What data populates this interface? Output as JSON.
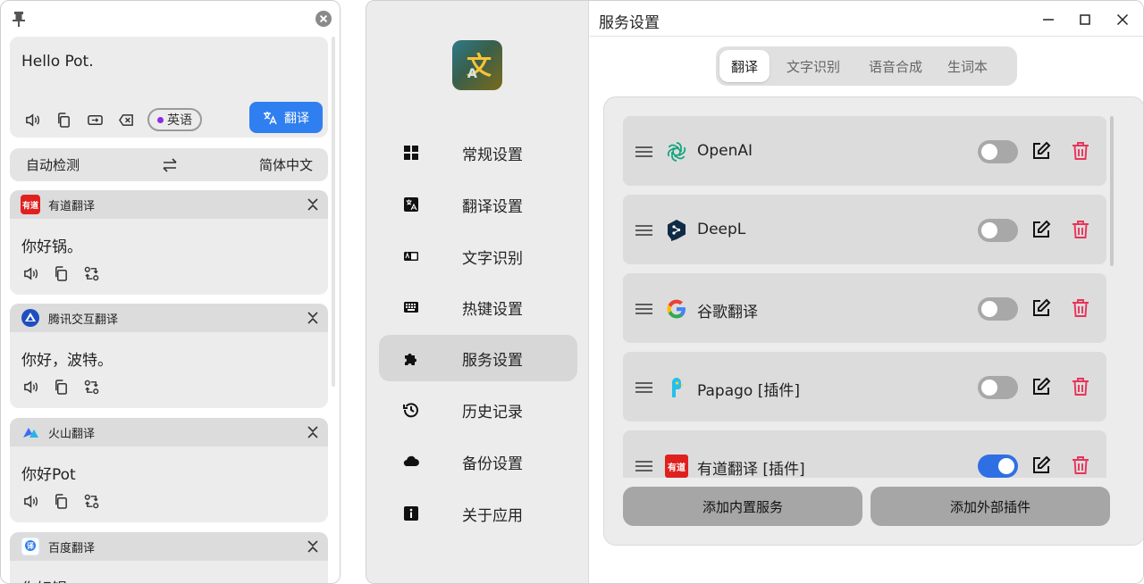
{
  "translate_window": {
    "source_text": "Hello Pot.",
    "detected_language": "英语",
    "translate_button": "翻译",
    "from_language": "自动检测",
    "to_language": "简体中文",
    "swap_icon": "swap-icon",
    "results": [
      {
        "service": "有道翻译",
        "logo_text": "有道",
        "logo_color": "#e0201f",
        "text": "你好锅。"
      },
      {
        "service": "腾讯交互翻译",
        "logo_color": "#1f4fbf",
        "text": "你好，波特。"
      },
      {
        "service": "火山翻译",
        "logo_color": "#3a6df0",
        "text": "你好Pot"
      },
      {
        "service": "百度翻译",
        "logo_color": "#2f7ff0",
        "text": "你好锅"
      }
    ]
  },
  "settings_window": {
    "title": "服务设置",
    "nav": [
      {
        "label": "常规设置",
        "icon": "grid-icon"
      },
      {
        "label": "翻译设置",
        "icon": "translate-icon"
      },
      {
        "label": "文字识别",
        "icon": "ocr-icon"
      },
      {
        "label": "热键设置",
        "icon": "keyboard-icon"
      },
      {
        "label": "服务设置",
        "icon": "puzzle-icon",
        "active": true
      },
      {
        "label": "历史记录",
        "icon": "history-icon"
      },
      {
        "label": "备份设置",
        "icon": "cloud-icon"
      },
      {
        "label": "关于应用",
        "icon": "info-icon"
      }
    ],
    "tabs": [
      {
        "label": "翻译",
        "active": true
      },
      {
        "label": "文字识别"
      },
      {
        "label": "语音合成"
      },
      {
        "label": "生词本"
      }
    ],
    "services": [
      {
        "name": "OpenAI",
        "enabled": false,
        "icon": "openai-icon"
      },
      {
        "name": "DeepL",
        "enabled": false,
        "icon": "deepl-icon"
      },
      {
        "name": "谷歌翻译",
        "enabled": false,
        "icon": "google-icon"
      },
      {
        "name": "Papago [插件]",
        "enabled": false,
        "icon": "papago-icon"
      },
      {
        "name": "有道翻译 [插件]",
        "enabled": true,
        "icon": "youdao-icon",
        "logo_text": "有道"
      }
    ],
    "add_builtin": "添加内置服务",
    "add_plugin": "添加外部插件",
    "accent_color": "#2f6fe4",
    "delete_color": "#e8335a"
  }
}
